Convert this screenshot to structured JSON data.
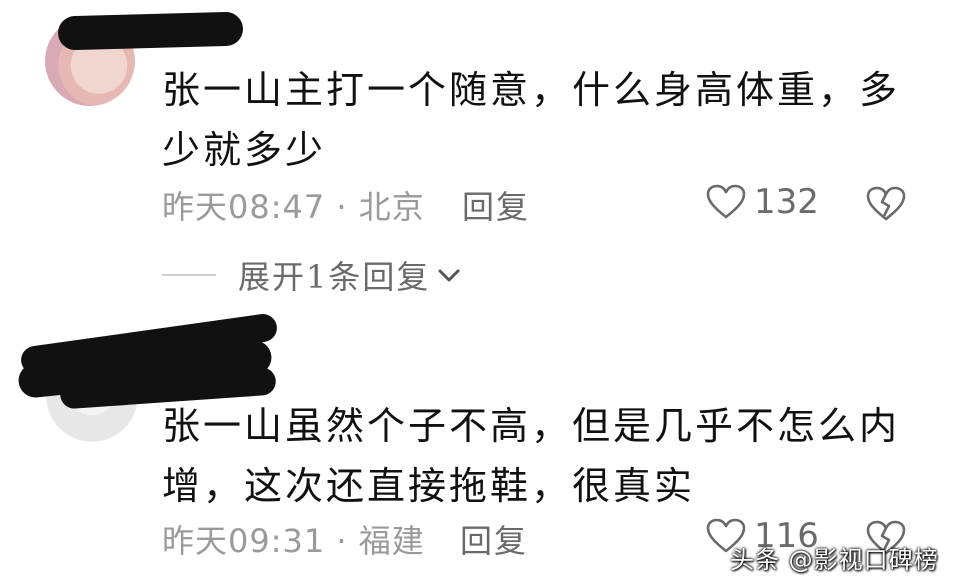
{
  "comments": [
    {
      "text_line1": "张一山主打一个随意，什么身高体重，多",
      "text_line2": "少就多少",
      "meta": "昨天08:47 · 北京",
      "reply_label": "回复",
      "likes": "132",
      "expand_label": "展开1条回复"
    },
    {
      "text_line1": "张一山虽然个子不高，但是几乎不怎么内",
      "text_line2": "增，这次还直接拖鞋，很真实",
      "meta": "昨天09:31 · 福建",
      "reply_label": "回复",
      "likes": "116"
    }
  ],
  "watermark": "头条 @影视口碑榜",
  "icons": {
    "like": "heart-outline-icon",
    "dislike": "broken-heart-icon",
    "expand": "chevron-down-icon"
  }
}
